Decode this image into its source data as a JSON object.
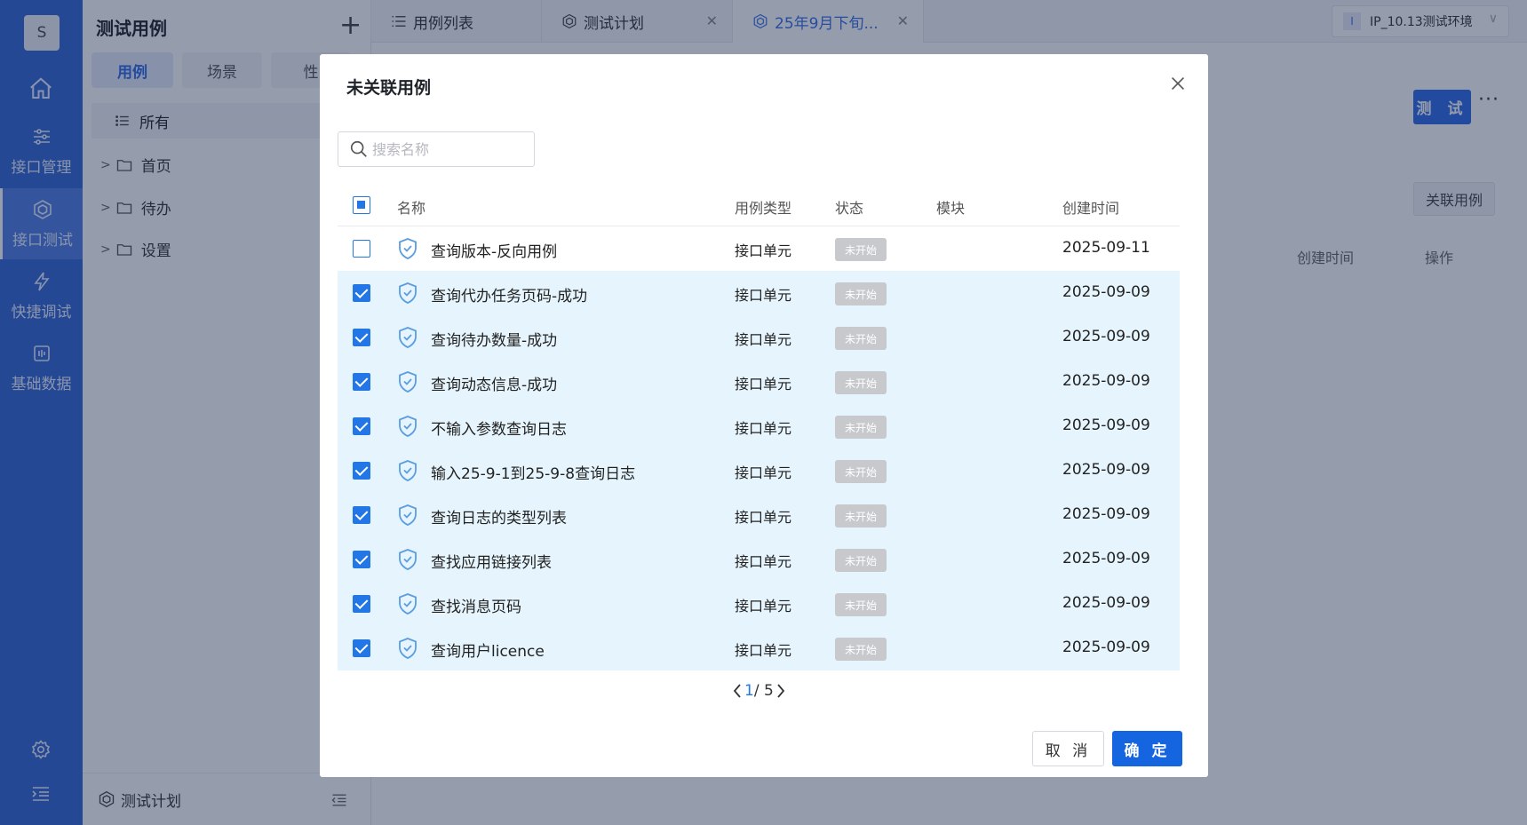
{
  "rail": {
    "avatar": "S",
    "items": [
      {
        "label": "接口管理",
        "icon": "sliders-icon"
      },
      {
        "label": "接口测试",
        "icon": "cube-icon"
      },
      {
        "label": "快捷调试",
        "icon": "lightning-icon"
      },
      {
        "label": "基础数据",
        "icon": "chart-icon"
      }
    ]
  },
  "sidebar": {
    "title": "测试用例",
    "segments": [
      "用例",
      "场景",
      "性"
    ],
    "all_label": "所有",
    "tree": [
      "首页",
      "待办",
      "设置"
    ],
    "footer_label": "测试计划"
  },
  "tabs": [
    {
      "label": "用例列表"
    },
    {
      "label": "测试计划"
    },
    {
      "label": "25年9月下旬..."
    }
  ],
  "env": {
    "badge": "I",
    "label": "IP_10.13测试环境"
  },
  "main": {
    "test_button": "测 试",
    "link_button": "关联用例",
    "columns": [
      "创建时间",
      "操作"
    ]
  },
  "modal": {
    "title": "未关联用例",
    "search_placeholder": "搜索名称",
    "headers": {
      "name": "名称",
      "type": "用例类型",
      "status": "状态",
      "module": "模块",
      "created": "创建时间"
    },
    "rows": [
      {
        "name": "查询版本-反向用例",
        "type": "接口单元",
        "status": "未开始",
        "module": "",
        "created": "2025-09-11",
        "checked": false
      },
      {
        "name": "查询代办任务页码-成功",
        "type": "接口单元",
        "status": "未开始",
        "module": "",
        "created": "2025-09-09",
        "checked": true
      },
      {
        "name": "查询待办数量-成功",
        "type": "接口单元",
        "status": "未开始",
        "module": "",
        "created": "2025-09-09",
        "checked": true
      },
      {
        "name": "查询动态信息-成功",
        "type": "接口单元",
        "status": "未开始",
        "module": "",
        "created": "2025-09-09",
        "checked": true
      },
      {
        "name": "不输入参数查询日志",
        "type": "接口单元",
        "status": "未开始",
        "module": "",
        "created": "2025-09-09",
        "checked": true
      },
      {
        "name": "输入25-9-1到25-9-8查询日志",
        "type": "接口单元",
        "status": "未开始",
        "module": "",
        "created": "2025-09-09",
        "checked": true
      },
      {
        "name": "查询日志的类型列表",
        "type": "接口单元",
        "status": "未开始",
        "module": "",
        "created": "2025-09-09",
        "checked": true
      },
      {
        "name": "查找应用链接列表",
        "type": "接口单元",
        "status": "未开始",
        "module": "",
        "created": "2025-09-09",
        "checked": true
      },
      {
        "name": "查找消息页码",
        "type": "接口单元",
        "status": "未开始",
        "module": "",
        "created": "2025-09-09",
        "checked": true
      },
      {
        "name": "查询用户licence",
        "type": "接口单元",
        "status": "未开始",
        "module": "",
        "created": "2025-09-09",
        "checked": true
      }
    ],
    "pager": {
      "current": "1",
      "total": "/ 5"
    },
    "cancel_label": "取 消",
    "ok_label": "确 定"
  },
  "colors": {
    "primary": "#1565e0",
    "rail": "#3366d6",
    "selected_row": "#e6f5fd",
    "status_badge": "#c7c9cd"
  }
}
